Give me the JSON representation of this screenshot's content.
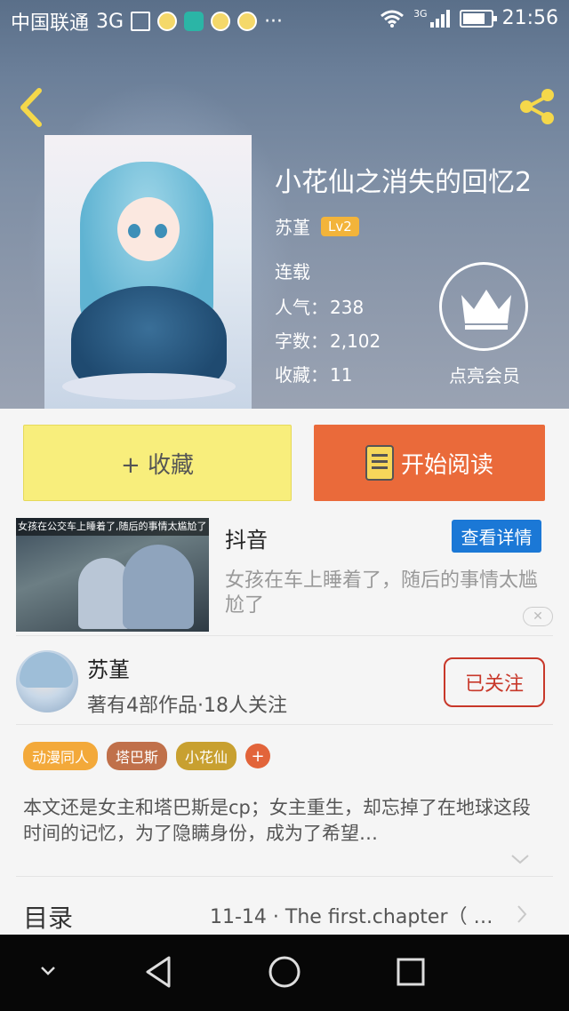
{
  "status_bar": {
    "carrier": "中国联通",
    "network": "3G",
    "signal_network": "3G",
    "time": "21:56",
    "more": "···"
  },
  "book": {
    "title": "小花仙之消失的回忆2",
    "author": "苏堇",
    "level": "Lv2",
    "status": "连载",
    "stats": [
      {
        "label": "人气：",
        "value": "238"
      },
      {
        "label": "字数：",
        "value": "2,102"
      },
      {
        "label": "收藏：",
        "value": "11"
      }
    ],
    "member_label": "点亮会员"
  },
  "actions": {
    "collect_label": "+ 收藏",
    "read_label": "开始阅读"
  },
  "ad": {
    "thumb_caption": "女孩在公交车上睡着了,随后的事情太尴尬了",
    "name": "抖音",
    "detail_label": "查看详情",
    "description": "女孩在车上睡着了，随后的事情太尴尬了",
    "close": "✕"
  },
  "author_info": {
    "name": "苏堇",
    "meta": "著有4部作品·18人关注",
    "follow_label": "已关注"
  },
  "tags": [
    {
      "label": "动漫同人",
      "color": "#f3a93a"
    },
    {
      "label": "塔巴斯",
      "color": "#c0704a"
    },
    {
      "label": "小花仙",
      "color": "#c8a030"
    }
  ],
  "tag_add": "+",
  "description": "本文还是女主和塔巴斯是cp；女主重生，却忘掉了在地球这段时间的记忆，为了隐瞒身份，成为了希望…",
  "toc": {
    "label": "目录",
    "latest_chapter": "11-14 · The first.chapter（ …"
  }
}
